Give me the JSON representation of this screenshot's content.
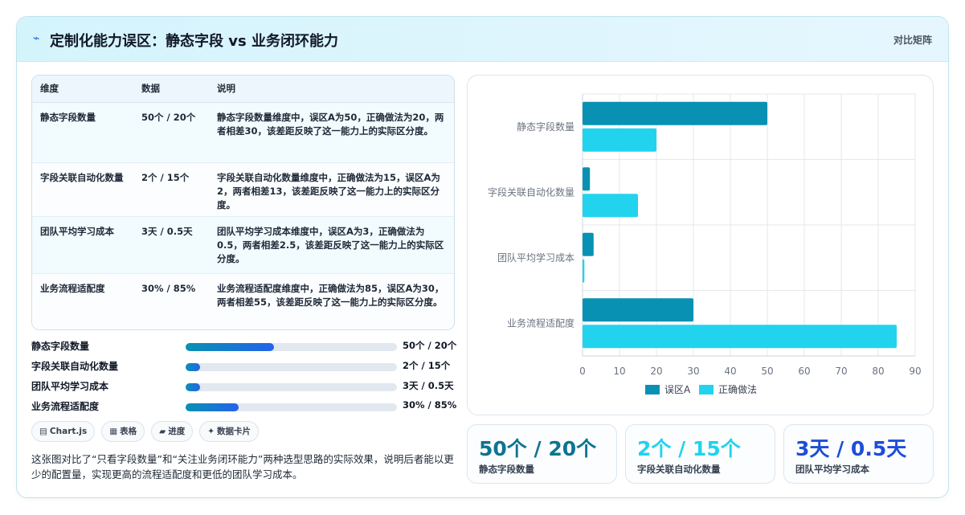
{
  "header": {
    "title": "定制化能力误区：静态字段 vs 业务闭环能力",
    "tag": "对比矩阵",
    "icon": "bolt-icon"
  },
  "table": {
    "columns": [
      "维度",
      "数据",
      "说明"
    ],
    "rows": [
      {
        "dimension": "静态字段数量",
        "data": "50个 / 20个",
        "note": "静态字段数量维度中，误区A为50，正确做法为20，两者相差30，该差距反映了这一能力上的实际区分度。"
      },
      {
        "dimension": "字段关联自动化数量",
        "data": "2个 / 15个",
        "note": "字段关联自动化数量维度中，正确做法为15，误区A为2，两者相差13，该差距反映了这一能力上的实际区分度。"
      },
      {
        "dimension": "团队平均学习成本",
        "data": "3天 / 0.5天",
        "note": "团队平均学习成本维度中，误区A为3，正确做法为0.5，两者相差2.5，该差距反映了这一能力上的实际区分度。"
      },
      {
        "dimension": "业务流程适配度",
        "data": "30% / 85%",
        "note": "业务流程适配度维度中，正确做法为85，误区A为30，两者相差55，该差距反映了这一能力上的实际区分度。"
      }
    ]
  },
  "progress": [
    {
      "label": "静态字段数量",
      "value": "50个 / 20个",
      "fraction": 0.42
    },
    {
      "label": "字段关联自动化数量",
      "value": "2个 / 15个",
      "fraction": 0.07
    },
    {
      "label": "团队平均学习成本",
      "value": "3天 / 0.5天",
      "fraction": 0.07
    },
    {
      "label": "业务流程适配度",
      "value": "30% / 85%",
      "fraction": 0.25
    }
  ],
  "pills": [
    {
      "icon": "▤",
      "label": "Chart.js"
    },
    {
      "icon": "▦",
      "label": "表格"
    },
    {
      "icon": "▰",
      "label": "进度"
    },
    {
      "icon": "✦",
      "label": "数据卡片"
    }
  ],
  "description": "这张图对比了“只看字段数量”和“关注业务闭环能力”两种选型思路的实际效果，说明后者能以更少的配置量，实现更高的流程适配度和更低的团队学习成本。",
  "kpis": [
    {
      "value": "50个 / 20个",
      "label": "静态字段数量",
      "color": "#0e7490"
    },
    {
      "value": "2个 / 15个",
      "label": "字段关联自动化数量",
      "color": "#22d3ee"
    },
    {
      "value": "3天 / 0.5天",
      "label": "团队平均学习成本",
      "color": "#1d4ed8"
    }
  ],
  "chart_data": {
    "type": "bar",
    "orientation": "horizontal",
    "categories": [
      "静态字段数量",
      "字段关联自动化数量",
      "团队平均学习成本",
      "业务流程适配度"
    ],
    "series": [
      {
        "name": "误区A",
        "values": [
          50,
          2,
          3,
          30
        ],
        "color": "#0891b2"
      },
      {
        "name": "正确做法",
        "values": [
          20,
          15,
          0.5,
          85
        ],
        "color": "#22d3ee"
      }
    ],
    "xlim": [
      0,
      90
    ],
    "xticks": [
      0,
      10,
      20,
      30,
      40,
      50,
      60,
      70,
      80,
      90
    ],
    "grid": true,
    "legend": "bottom"
  }
}
